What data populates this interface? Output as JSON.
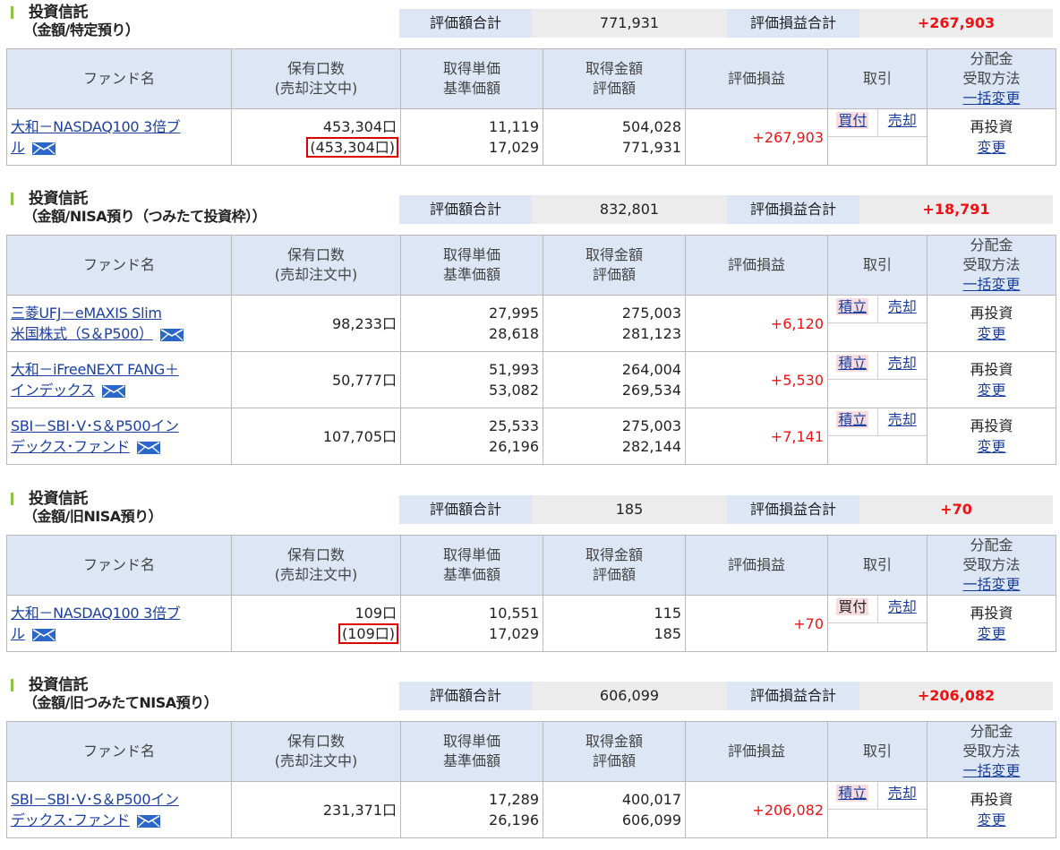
{
  "labels": {
    "total_value": "評価額合計",
    "total_pl": "評価損益合計",
    "col_fund": "ファンド名",
    "col_units_1": "保有口数",
    "col_units_2": "(売却注文中)",
    "col_cost_1": "取得単価",
    "col_cost_2": "基準価額",
    "col_amount_1": "取得金額",
    "col_amount_2": "評価額",
    "col_pl": "評価損益",
    "col_trade": "取引",
    "col_dist_1": "分配金",
    "col_dist_2": "受取方法",
    "col_dist_3": "一括変更",
    "reinvest": "再投資",
    "change": "変更"
  },
  "sections": [
    {
      "title1": "投資信託",
      "title2": "（金額/特定預り）",
      "total_value": "771,931",
      "total_pl": "+267,903",
      "rows": [
        {
          "fund1": "大和－NASDAQ100 3倍ブ",
          "fund2": "ル",
          "units": "453,304口",
          "units_pending": "(453,304口)",
          "cost": "11,119",
          "nav": "17,029",
          "amount": "504,028",
          "value": "771,931",
          "pl": "+267,903",
          "trade1": "買付",
          "trade1_link": true,
          "trade2": "売却"
        }
      ]
    },
    {
      "title1": "投資信託",
      "title2": "（金額/NISA預り（つみたて投資枠））",
      "total_value": "832,801",
      "total_pl": "+18,791",
      "rows": [
        {
          "fund1": "三菱UFJ－eMAXIS Slim",
          "fund2": "米国株式（S＆P500）",
          "units": "98,233口",
          "units_pending": "",
          "cost": "27,995",
          "nav": "28,618",
          "amount": "275,003",
          "value": "281,123",
          "pl": "+6,120",
          "trade1": "積立",
          "trade1_link": true,
          "trade2": "売却"
        },
        {
          "fund1": "大和－iFreeNEXT FANG＋",
          "fund2": "インデックス",
          "units": "50,777口",
          "units_pending": "",
          "cost": "51,993",
          "nav": "53,082",
          "amount": "264,004",
          "value": "269,534",
          "pl": "+5,530",
          "trade1": "積立",
          "trade1_link": true,
          "trade2": "売却"
        },
        {
          "fund1": "SBI－SBI･V･S＆P500イン",
          "fund2": "デックス･ファンド",
          "units": "107,705口",
          "units_pending": "",
          "cost": "25,533",
          "nav": "26,196",
          "amount": "275,003",
          "value": "282,144",
          "pl": "+7,141",
          "trade1": "積立",
          "trade1_link": true,
          "trade2": "売却"
        }
      ]
    },
    {
      "title1": "投資信託",
      "title2": "（金額/旧NISA預り）",
      "total_value": "185",
      "total_pl": "+70",
      "rows": [
        {
          "fund1": "大和－NASDAQ100 3倍ブ",
          "fund2": "ル",
          "units": "109口",
          "units_pending": "(109口)",
          "cost": "10,551",
          "nav": "17,029",
          "amount": "115",
          "value": "185",
          "pl": "+70",
          "trade1": "買付",
          "trade1_link": false,
          "trade2": "売却"
        }
      ]
    },
    {
      "title1": "投資信託",
      "title2": "（金額/旧つみたてNISA預り）",
      "total_value": "606,099",
      "total_pl": "+206,082",
      "rows": [
        {
          "fund1": "SBI－SBI･V･S＆P500イン",
          "fund2": "デックス･ファンド",
          "units": "231,371口",
          "units_pending": "",
          "cost": "17,289",
          "nav": "26,196",
          "amount": "400,017",
          "value": "606,099",
          "pl": "+206,082",
          "trade1": "積立",
          "trade1_link": true,
          "trade2": "売却"
        }
      ]
    }
  ]
}
